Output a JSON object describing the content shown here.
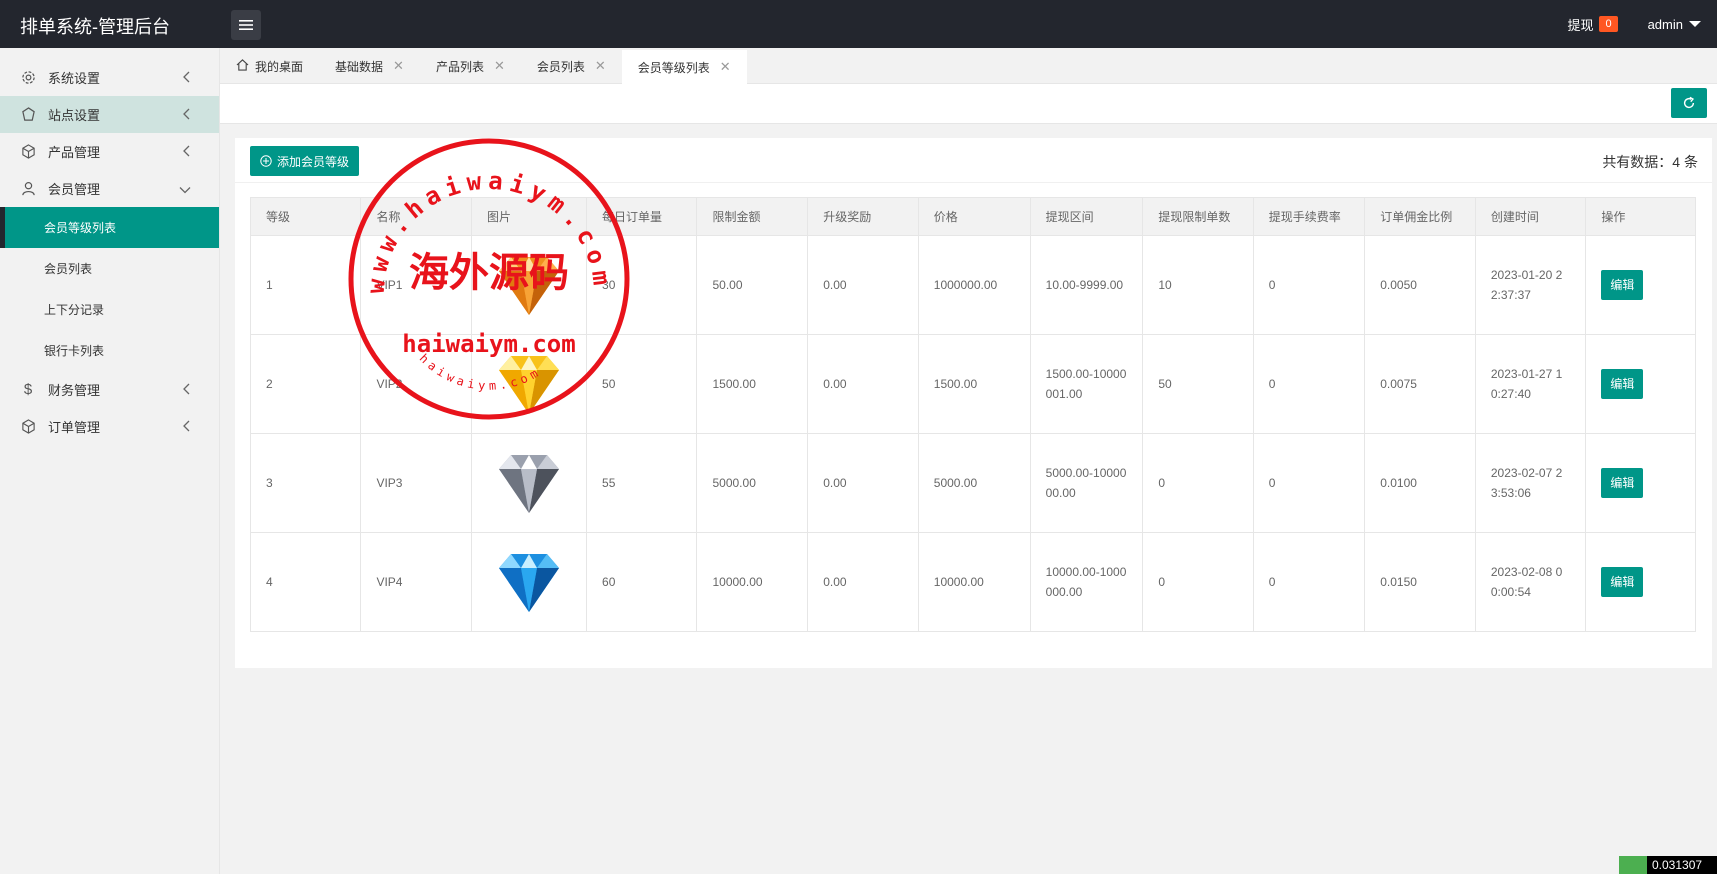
{
  "header": {
    "app_title": "排单系统-管理后台",
    "withdraw_label": "提现",
    "withdraw_count": "0",
    "user_name": "admin"
  },
  "sidebar": {
    "items": [
      {
        "label": "系统设置",
        "icon": "gear-icon"
      },
      {
        "label": "站点设置",
        "icon": "site-icon"
      },
      {
        "label": "产品管理",
        "icon": "cube-icon"
      },
      {
        "label": "会员管理",
        "icon": "user-icon"
      },
      {
        "label": "财务管理",
        "icon": "dollar-icon"
      },
      {
        "label": "订单管理",
        "icon": "cube-icon"
      }
    ],
    "sub_items": [
      {
        "label": "会员等级列表"
      },
      {
        "label": "会员列表"
      },
      {
        "label": "上下分记录"
      },
      {
        "label": "银行卡列表"
      }
    ]
  },
  "tabs": [
    {
      "label": "我的桌面"
    },
    {
      "label": "基础数据"
    },
    {
      "label": "产品列表"
    },
    {
      "label": "会员列表"
    },
    {
      "label": "会员等级列表"
    }
  ],
  "toolbar": {
    "add_label": "添加会员等级",
    "total_text": "共有数据：4 条"
  },
  "table": {
    "headers": [
      "等级",
      "名称",
      "图片",
      "每日订单量",
      "限制金额",
      "升级奖励",
      "价格",
      "提现区间",
      "提现限制单数",
      "提现手续费率",
      "订单佣金比例",
      "创建时间",
      "操作"
    ],
    "rows": [
      {
        "level": "1",
        "name": "VIP1",
        "daily_orders": "30",
        "limit": "50.00",
        "reward": "0.00",
        "price": "1000000.00",
        "range": "10.00-9999.00",
        "limit_count": "10",
        "fee": "0",
        "commission": "0.0050",
        "created": "2023-01-20 22:37:37",
        "action": "编辑",
        "gem": "orange"
      },
      {
        "level": "2",
        "name": "VIP2",
        "daily_orders": "50",
        "limit": "1500.00",
        "reward": "0.00",
        "price": "1500.00",
        "range": "1500.00-10000001.00",
        "limit_count": "50",
        "fee": "0",
        "commission": "0.0075",
        "created": "2023-01-27 10:27:40",
        "action": "编辑",
        "gem": "yellow"
      },
      {
        "level": "3",
        "name": "VIP3",
        "daily_orders": "55",
        "limit": "5000.00",
        "reward": "0.00",
        "price": "5000.00",
        "range": "5000.00-1000000.00",
        "limit_count": "0",
        "fee": "0",
        "commission": "0.0100",
        "created": "2023-02-07 23:53:06",
        "action": "编辑",
        "gem": "silver"
      },
      {
        "level": "4",
        "name": "VIP4",
        "daily_orders": "60",
        "limit": "10000.00",
        "reward": "0.00",
        "price": "10000.00",
        "range": "10000.00-1000000.00",
        "limit_count": "0",
        "fee": "0",
        "commission": "0.0150",
        "created": "2023-02-08 00:00:54",
        "action": "编辑",
        "gem": "blue"
      }
    ]
  },
  "watermark": {
    "top_arc": "www.haiwaiym.com",
    "center": "海外源码",
    "bottom": "haiwaiym.com",
    "small_arc": "haiwaiym.com"
  },
  "corner_widget": {
    "text": "0.031307"
  },
  "colors": {
    "accent": "#009688",
    "topbar": "#23262e",
    "badge": "#ff5722",
    "stamp": "#e8131b"
  }
}
